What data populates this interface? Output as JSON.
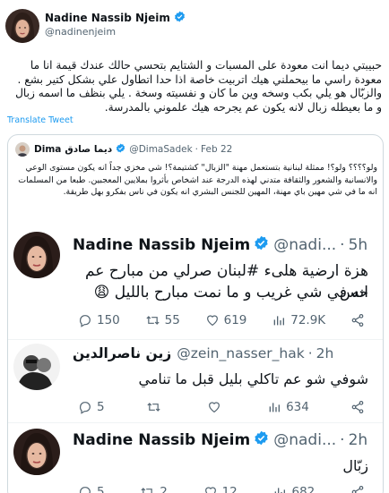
{
  "main": {
    "name": "Nadine Nassib Njeim",
    "handle": "@nadinenjeim",
    "text": "حبيبتي ديما انت معودة على المسبات و الشتايم بتحسي حالك عندك قيمة انا ما معودة راسي ما بيحملني هيك اتربيت خاصة اذا حدا اتطاول علي بشكل كتير بشع . والزبّال هو يلي بكب وسخه وين ما كان و نفسيته وسخة . يلي بنظف ما اسمه زبال و ما بعيطله زبال لانه يكون عم يجرحه هيك علموني بالمدرسة.",
    "translate": "Translate Tweet"
  },
  "quote": {
    "name_ar": "ديما صادق",
    "name_en": "Dima",
    "handle": "@DimaSadek",
    "date": "Feb 22",
    "text": "ولو؟؟؟؟ ولو؟! ممثلة لبنانية  بتستعمل مهنة \"الزبال\" كشتيمة؟! شي مخزي جداً انه يكون مستوى الوعي والانسانية والشعور والثقافة متدني لهذه الدرجة عند اشخاص بأثروا بملايين المعجبين. طبعا من المسلمات انه ما في شي مهين باي مهنة، المهين للجنس البشري انه يكون في ناس بفكرو بهل طريقة."
  },
  "embeds": [
    {
      "name": "Nadine Nassib Njeim",
      "handle": "@nadi...",
      "time": "5h",
      "text_line1": "هزة ارضية هلىء #لبنان صرلي من مبارح عم حس",
      "text_line2": "انه في شي غريب و ما نمت مبارح بالليل 😩",
      "replies": "150",
      "retweets": "55",
      "likes": "619",
      "views": "72.9K"
    },
    {
      "name": "زين ناصرالدين",
      "handle": "@zein_nasser_hak",
      "time": "2h",
      "text_line1": "شوفي شو عم تاكلي بليل قبل ما تنامي",
      "replies": "5",
      "retweets": "",
      "likes": "",
      "views": "634"
    },
    {
      "name": "Nadine Nassib Njeim",
      "handle": "@nadi...",
      "time": "2h",
      "text_line1": "زبّال",
      "replies": "5",
      "retweets": "2",
      "likes": "12",
      "views": "682"
    }
  ],
  "colors": {
    "verified": "#1d9bf0",
    "link": "#1d9bf0",
    "muted": "#536471",
    "border": "#cfd9de"
  }
}
